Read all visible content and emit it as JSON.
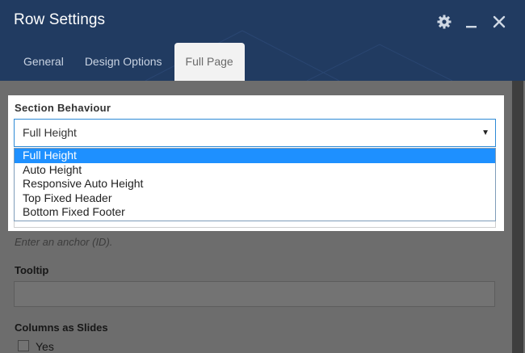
{
  "window": {
    "title": "Row Settings",
    "icons": [
      "gear-icon",
      "minimize-icon",
      "close-icon"
    ]
  },
  "tabs": [
    {
      "label": "General",
      "active": false
    },
    {
      "label": "Design Options",
      "active": false
    },
    {
      "label": "Full Page",
      "active": true
    }
  ],
  "section_behaviour": {
    "label": "Section Behaviour",
    "selected": "Full Height",
    "options": [
      "Full Height",
      "Auto Height",
      "Responsive Auto Height",
      "Top Fixed Header",
      "Bottom Fixed Footer"
    ]
  },
  "anchor": {
    "hint": "Enter an anchor (ID)."
  },
  "tooltip": {
    "label": "Tooltip",
    "value": ""
  },
  "columns_as_slides": {
    "label": "Columns as Slides",
    "checkbox_label": "Yes",
    "checked": false
  },
  "colors": {
    "header_bg": "#213b61",
    "select_border": "#2d8ad6",
    "option_highlight": "#1e90ff"
  }
}
